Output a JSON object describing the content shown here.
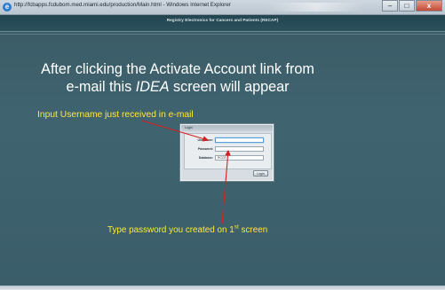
{
  "window": {
    "title": "http://fcbapps.fcdubom.med.miami.edu/production/Main.html - Windows Internet Explorer",
    "ie_icon_glyph": "e",
    "minimize": "–",
    "maximize": "□",
    "close": "x"
  },
  "app": {
    "header_title": "Registry Electronics for Cancers and Patients (RECAP)"
  },
  "annotations": {
    "headline_line1": "After clicking the Activate Account link from",
    "headline_line2_pre": "e-mail this ",
    "headline_line2_em": "IDEA",
    "headline_line2_post": " screen will appear",
    "username_note": "Input Username just received in e-mail",
    "password_note_pre": "Type password you created on 1",
    "password_note_sup": "st",
    "password_note_post": " screen",
    "annotation_color": "#ffe93a",
    "arrow_color": "#d42020"
  },
  "login": {
    "title": "Login",
    "username_label": "Username:",
    "username_value": "",
    "password_label": "Password:",
    "password_value": "",
    "database_label": "Database:",
    "database_value": "RCCR",
    "login_button": "Login"
  }
}
